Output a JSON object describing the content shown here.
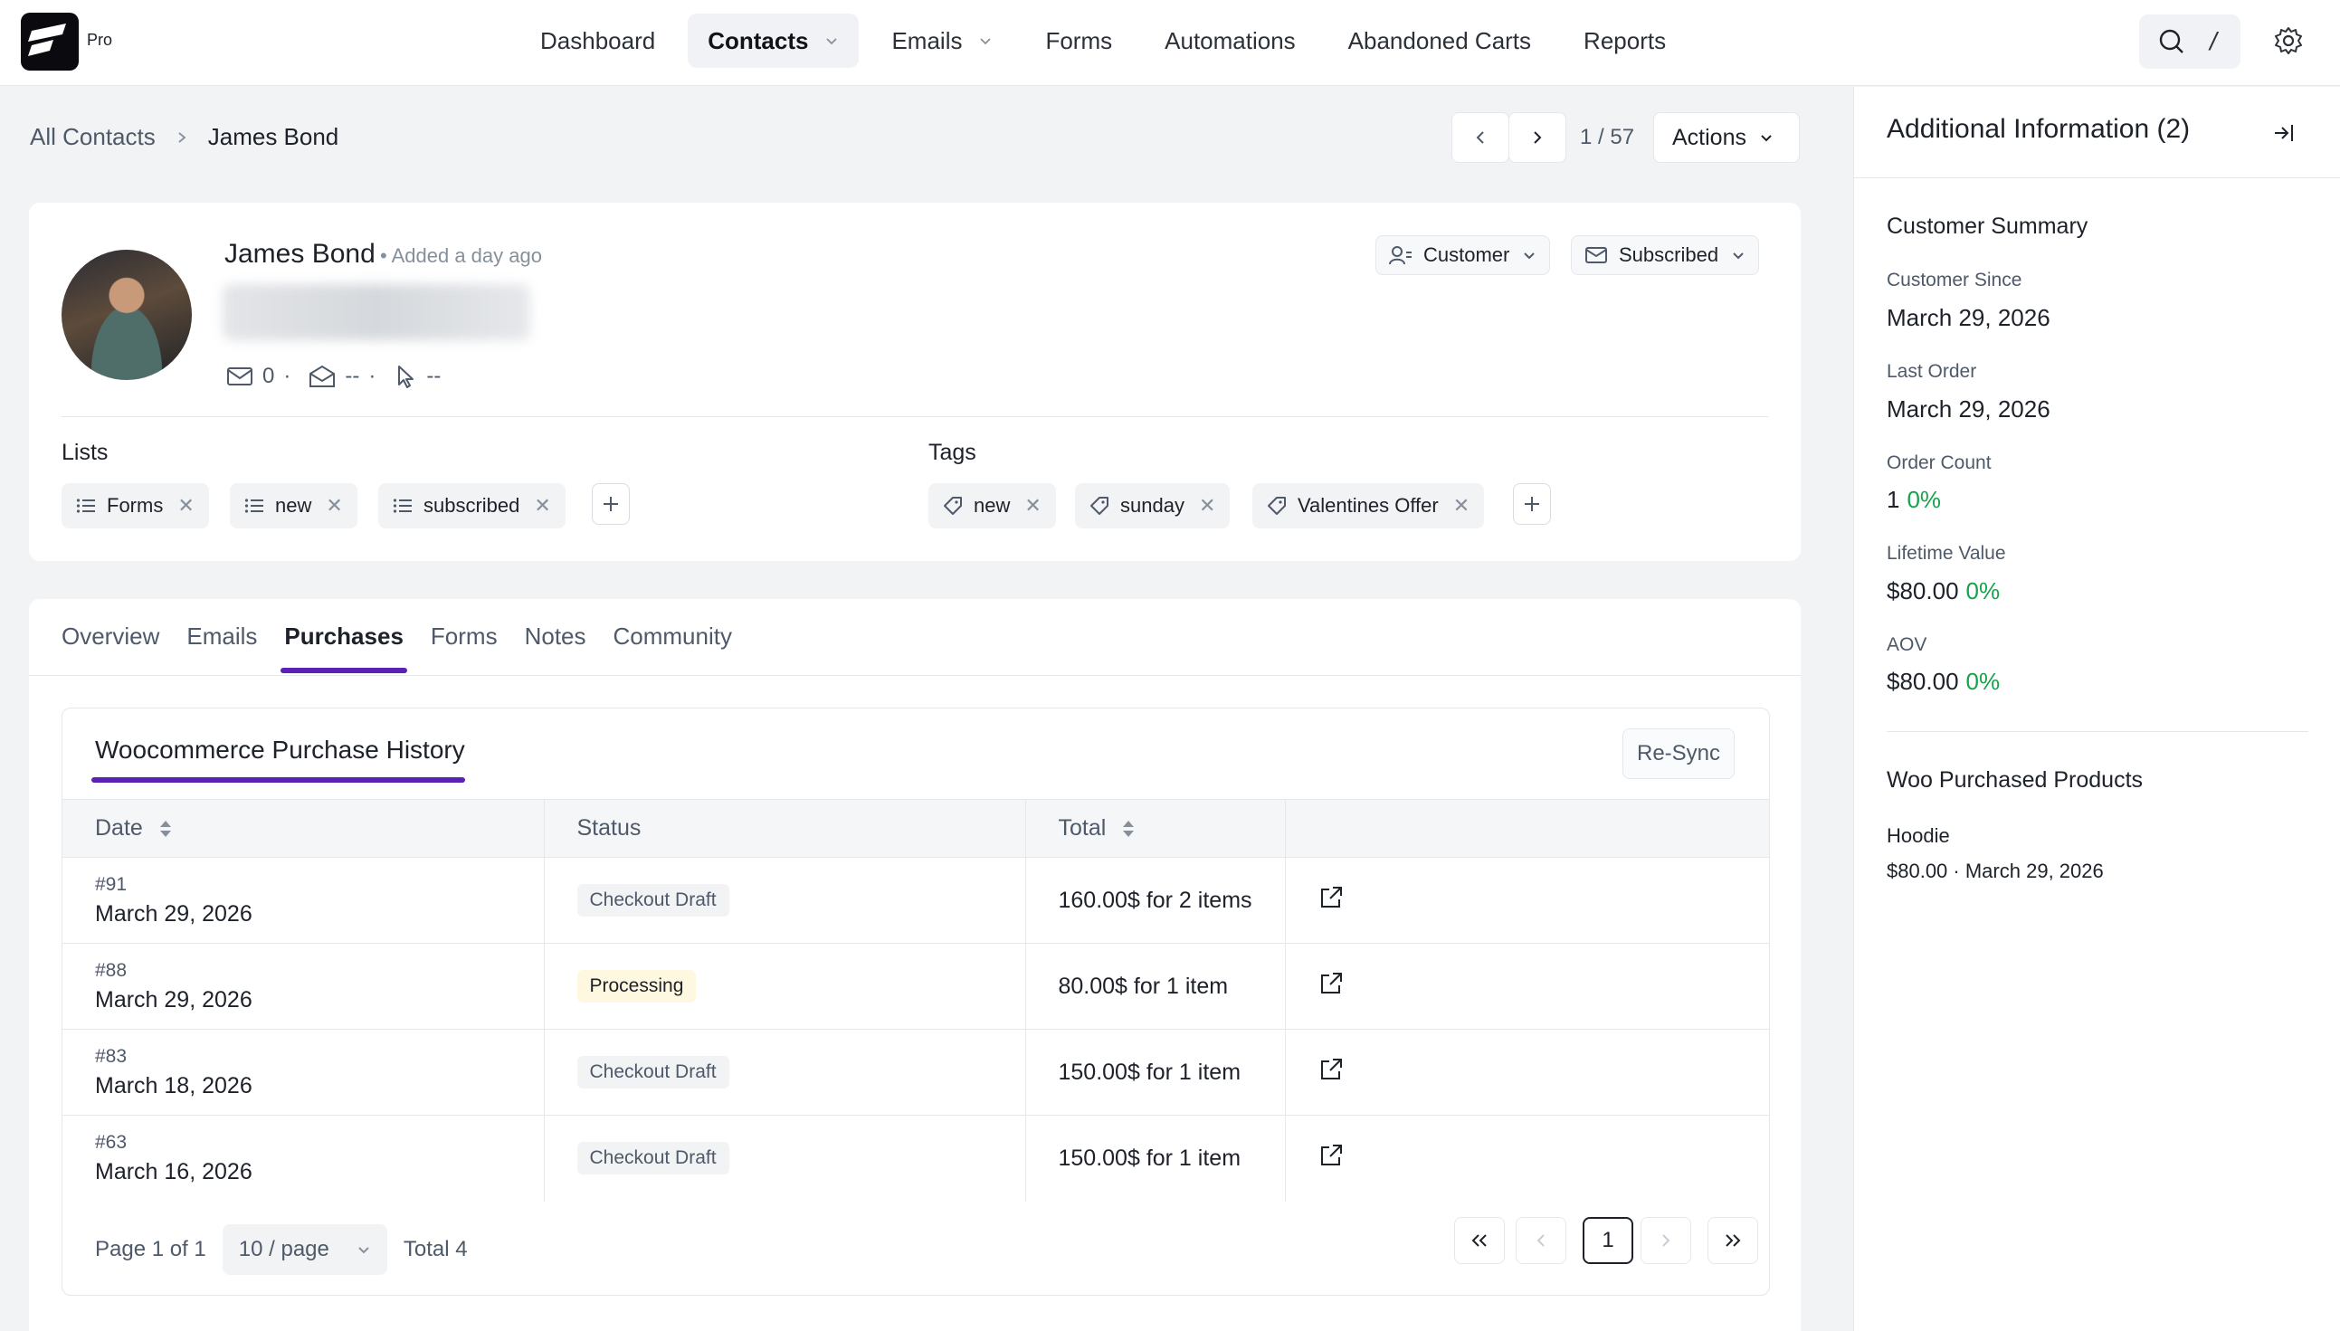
{
  "app": {
    "logo_badge": "Pro"
  },
  "nav": {
    "items": [
      {
        "label": "Dashboard",
        "dropdown": false,
        "active": false
      },
      {
        "label": "Contacts",
        "dropdown": true,
        "active": true
      },
      {
        "label": "Emails",
        "dropdown": true,
        "active": false
      },
      {
        "label": "Forms",
        "dropdown": false,
        "active": false
      },
      {
        "label": "Automations",
        "dropdown": false,
        "active": false
      },
      {
        "label": "Abandoned Carts",
        "dropdown": false,
        "active": false
      },
      {
        "label": "Reports",
        "dropdown": false,
        "active": false
      }
    ],
    "shortcut_hint": "/"
  },
  "breadcrumb": {
    "root": "All Contacts",
    "current": "James Bond"
  },
  "pager": {
    "count": "1 / 57"
  },
  "actions": {
    "label": "Actions"
  },
  "profile": {
    "name": "James Bond",
    "meta": "• Added a day ago",
    "stats": {
      "sent": "0",
      "opened": "--",
      "clicked": "--"
    },
    "type_label": "Customer",
    "status_label": "Subscribed"
  },
  "lists": {
    "title": "Lists",
    "items": [
      "Forms",
      "new",
      "subscribed"
    ]
  },
  "tags": {
    "title": "Tags",
    "items": [
      "new",
      "sunday",
      "Valentines Offer"
    ]
  },
  "tabs": [
    "Overview",
    "Emails",
    "Purchases",
    "Forms",
    "Notes",
    "Community"
  ],
  "active_tab": "Purchases",
  "history": {
    "title": "Woocommerce Purchase History",
    "resync_label": "Re-Sync",
    "columns": [
      "Date",
      "Status",
      "Total",
      ""
    ],
    "rows": [
      {
        "id": "#91",
        "date": "March 29, 2026",
        "status": "Checkout Draft",
        "total": "160.00$ for 2 items"
      },
      {
        "id": "#88",
        "date": "March 29, 2026",
        "status": "Processing",
        "total": "80.00$ for 1 item"
      },
      {
        "id": "#83",
        "date": "March 18, 2026",
        "status": "Checkout Draft",
        "total": "150.00$ for 1 item"
      },
      {
        "id": "#63",
        "date": "March 16, 2026",
        "status": "Checkout Draft",
        "total": "150.00$ for 1 item"
      }
    ],
    "footer": {
      "page_info": "Page 1 of 1",
      "per_page": "10 / page",
      "total": "Total 4",
      "current_page": "1"
    }
  },
  "panel": {
    "title": "Additional Information (2)",
    "summary_title": "Customer Summary",
    "fields": [
      {
        "label": "Customer Since",
        "value": "March 29, 2026",
        "pct": ""
      },
      {
        "label": "Last Order",
        "value": "March 29, 2026",
        "pct": ""
      },
      {
        "label": "Order Count",
        "value": "1",
        "pct": "0%"
      },
      {
        "label": "Lifetime Value",
        "value": "$80.00",
        "pct": "0%"
      },
      {
        "label": "AOV",
        "value": "$80.00",
        "pct": "0%"
      }
    ],
    "products_title": "Woo Purchased Products",
    "product": {
      "name": "Hoodie",
      "price": "$80.00",
      "date": "March 29, 2026"
    }
  },
  "colors": {
    "accent": "#5b21b6",
    "positive": "#16a34a",
    "processing_bg": "#fff8e1"
  }
}
